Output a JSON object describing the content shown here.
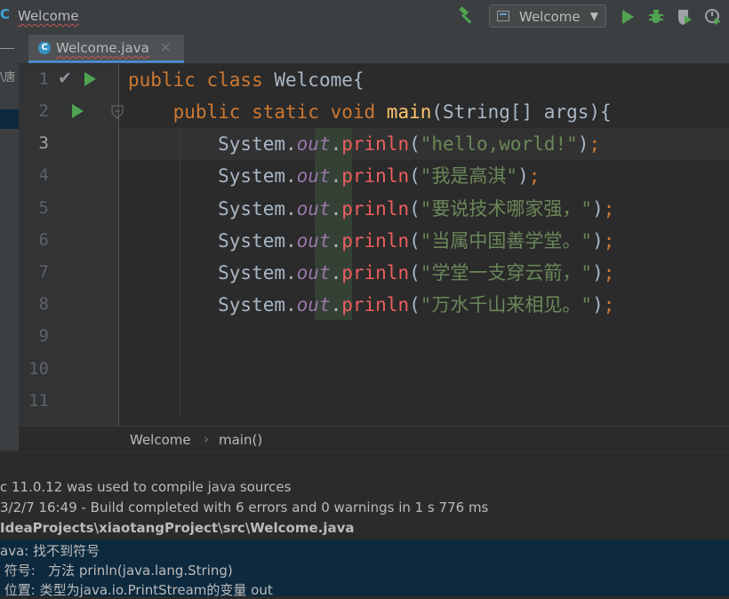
{
  "toolbar": {
    "project_name": "Welcome",
    "run_config": "Welcome",
    "icons": [
      "hammer-icon",
      "run-icon",
      "debug-icon",
      "coverage-icon",
      "profile-icon"
    ]
  },
  "leftstrip": {
    "fragment": "\\唐"
  },
  "tabs": [
    {
      "label": "Welcome.java",
      "close": "×",
      "icon": "java-class-icon"
    }
  ],
  "editor": {
    "line_numbers": [
      "1",
      "2",
      "3",
      "4",
      "5",
      "6",
      "7",
      "8",
      "9",
      "10",
      "11"
    ],
    "current_line": "3",
    "lines": [
      {
        "n": "1",
        "tokens": [
          {
            "t": "public class ",
            "c": "kw"
          },
          {
            "t": "Welcome{",
            "c": "plain"
          }
        ]
      },
      {
        "n": "2",
        "tokens": [
          {
            "t": "    public static void ",
            "c": "kw"
          },
          {
            "t": "main",
            "c": "fn"
          },
          {
            "t": "(String[] args){",
            "c": "plain"
          }
        ]
      },
      {
        "n": "3",
        "tokens": [
          {
            "t": "        System.",
            "c": "plain"
          },
          {
            "t": "out",
            "c": "fld"
          },
          {
            "t": ".",
            "c": "plain"
          },
          {
            "t": "prinln",
            "c": "err"
          },
          {
            "t": "(",
            "c": "plain"
          },
          {
            "t": "\"hello,world!\"",
            "c": "str"
          },
          {
            "t": ")",
            "c": "plain"
          },
          {
            "t": ";",
            "c": "semi"
          }
        ]
      },
      {
        "n": "4",
        "tokens": [
          {
            "t": "        System.",
            "c": "plain"
          },
          {
            "t": "out",
            "c": "fld"
          },
          {
            "t": ".",
            "c": "plain"
          },
          {
            "t": "prinln",
            "c": "err"
          },
          {
            "t": "(",
            "c": "plain"
          },
          {
            "t": "\"我是高淇\"",
            "c": "str"
          },
          {
            "t": ")",
            "c": "plain"
          },
          {
            "t": ";",
            "c": "semi"
          }
        ]
      },
      {
        "n": "5",
        "tokens": [
          {
            "t": "        System.",
            "c": "plain"
          },
          {
            "t": "out",
            "c": "fld"
          },
          {
            "t": ".",
            "c": "plain"
          },
          {
            "t": "prinln",
            "c": "err"
          },
          {
            "t": "(",
            "c": "plain"
          },
          {
            "t": "\"要说技术哪家强，\"",
            "c": "str"
          },
          {
            "t": ")",
            "c": "plain"
          },
          {
            "t": ";",
            "c": "semi"
          }
        ]
      },
      {
        "n": "6",
        "tokens": [
          {
            "t": "        System.",
            "c": "plain"
          },
          {
            "t": "out",
            "c": "fld"
          },
          {
            "t": ".",
            "c": "plain"
          },
          {
            "t": "prinln",
            "c": "err"
          },
          {
            "t": "(",
            "c": "plain"
          },
          {
            "t": "\"当属中国善学堂。\"",
            "c": "str"
          },
          {
            "t": ")",
            "c": "plain"
          },
          {
            "t": ";",
            "c": "semi"
          }
        ]
      },
      {
        "n": "7",
        "tokens": [
          {
            "t": "        System.",
            "c": "plain"
          },
          {
            "t": "out",
            "c": "fld"
          },
          {
            "t": ".",
            "c": "plain"
          },
          {
            "t": "prinln",
            "c": "err"
          },
          {
            "t": "(",
            "c": "plain"
          },
          {
            "t": "\"学堂一支穿云箭，\"",
            "c": "str"
          },
          {
            "t": ")",
            "c": "plain"
          },
          {
            "t": ";",
            "c": "semi"
          }
        ]
      },
      {
        "n": "8",
        "tokens": [
          {
            "t": "        System.",
            "c": "plain"
          },
          {
            "t": "out",
            "c": "fld"
          },
          {
            "t": ".",
            "c": "plain"
          },
          {
            "t": "prinln",
            "c": "err"
          },
          {
            "t": "(",
            "c": "plain"
          },
          {
            "t": "\"万水千山来相见。\"",
            "c": "str"
          },
          {
            "t": ")",
            "c": "plain"
          },
          {
            "t": ";",
            "c": "semi"
          }
        ]
      }
    ]
  },
  "breadcrumb": {
    "class_name": "Welcome",
    "separator": "›",
    "method": "main()"
  },
  "output": {
    "lines": [
      "c 11.0.12 was used to compile java sources",
      "3/2/7 16:49 - Build completed with 6 errors and 0 warnings in 1 s 776 ms",
      "IdeaProjects\\xiaotangProject\\src\\Welcome.java",
      "ava: 找不到符号",
      " 符号:   方法 prinln(java.lang.String)",
      " 位置: 类型为java.io.PrintStream的变量 out"
    ]
  },
  "colors": {
    "keyword": "#cc7832",
    "function": "#ffc66d",
    "field": "#9876aa",
    "error": "#ec5f5f",
    "string": "#6a8759",
    "text": "#a9b7c6",
    "run_green": "#4fa352",
    "selection": "#0d293e"
  }
}
